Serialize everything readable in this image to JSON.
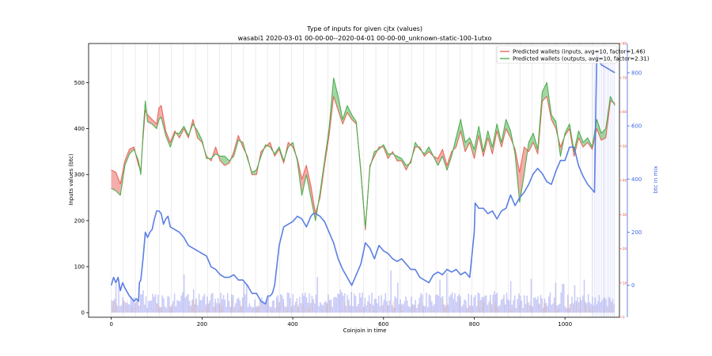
{
  "chart_data": {
    "type": "line",
    "title": "Type of inputs for given cjtx (values)",
    "subtitle": "wasabi1 2020-03-01 00-00-00--2020-04-01 00-00-00_unknown-static-100-1utxo",
    "xlabel": "Coinjoin in time",
    "ylabel_left": "Inputs values (btc)",
    "ylabel_right": "btc in mix",
    "xlim": [
      -50,
      1120
    ],
    "ylim_left": [
      -10,
      585
    ],
    "ylim_right1": [
      0,
      80
    ],
    "ylim_right2": [
      -120,
      910
    ],
    "x_ticks": [
      0,
      200,
      400,
      600,
      800,
      1000
    ],
    "y_ticks_left": [
      0,
      100,
      200,
      300,
      400,
      500
    ],
    "y_ticks_right1": [
      0,
      10,
      20,
      30,
      40,
      50,
      60,
      70,
      80
    ],
    "y_ticks_right2": [
      0,
      200,
      400,
      600,
      800
    ],
    "legend": {
      "placement": "top-right",
      "entries": [
        {
          "label": "Predicted wallets (inputs, avg=10, factor=1.46)",
          "color": "#e8685a"
        },
        {
          "label": "Predicted wallets (outputs, avg=10, factor=2.31)",
          "color": "#4caf50"
        }
      ]
    },
    "series": [
      {
        "name": "Predicted wallets (inputs, avg=10, factor=1.46)",
        "color": "#e8685a",
        "axis": "left",
        "x": [
          0,
          10,
          20,
          30,
          40,
          50,
          60,
          65,
          70,
          75,
          80,
          90,
          100,
          105,
          110,
          120,
          130,
          140,
          150,
          160,
          170,
          180,
          190,
          200,
          210,
          220,
          230,
          240,
          250,
          260,
          270,
          280,
          290,
          300,
          310,
          320,
          330,
          340,
          350,
          360,
          370,
          380,
          390,
          400,
          410,
          420,
          430,
          440,
          450,
          460,
          470,
          480,
          490,
          500,
          510,
          520,
          530,
          540,
          550,
          560,
          570,
          580,
          590,
          600,
          610,
          620,
          630,
          640,
          650,
          660,
          670,
          680,
          690,
          700,
          710,
          720,
          730,
          740,
          750,
          760,
          770,
          780,
          790,
          800,
          810,
          820,
          830,
          840,
          850,
          860,
          870,
          880,
          890,
          900,
          910,
          920,
          930,
          940,
          950,
          960,
          970,
          980,
          990,
          1000,
          1010,
          1020,
          1030,
          1040,
          1050,
          1060,
          1070,
          1080,
          1090,
          1100,
          1110
        ],
        "values": [
          310,
          305,
          280,
          330,
          355,
          360,
          320,
          310,
          380,
          440,
          430,
          420,
          410,
          445,
          450,
          395,
          370,
          395,
          380,
          400,
          380,
          420,
          380,
          370,
          340,
          330,
          360,
          330,
          320,
          325,
          350,
          385,
          360,
          340,
          300,
          300,
          350,
          360,
          370,
          340,
          355,
          325,
          370,
          360,
          335,
          290,
          320,
          275,
          215,
          250,
          320,
          385,
          470,
          440,
          410,
          435,
          420,
          410,
          310,
          180,
          320,
          340,
          360,
          360,
          335,
          350,
          330,
          330,
          310,
          330,
          360,
          360,
          340,
          350,
          340,
          335,
          355,
          320,
          350,
          360,
          395,
          350,
          370,
          335,
          385,
          340,
          380,
          345,
          395,
          360,
          400,
          380,
          355,
          305,
          360,
          350,
          370,
          345,
          460,
          470,
          420,
          400,
          360,
          385,
          400,
          340,
          380,
          360,
          370,
          355,
          400,
          375,
          380,
          460,
          455
        ]
      },
      {
        "name": "Predicted wallets (outputs, avg=10, factor=2.31)",
        "color": "#4caf50",
        "axis": "left",
        "x": [
          0,
          10,
          20,
          30,
          40,
          50,
          60,
          65,
          70,
          75,
          80,
          90,
          100,
          105,
          110,
          120,
          130,
          140,
          150,
          160,
          170,
          180,
          190,
          200,
          210,
          220,
          230,
          240,
          250,
          260,
          270,
          280,
          290,
          300,
          310,
          320,
          330,
          340,
          350,
          360,
          370,
          380,
          390,
          400,
          410,
          420,
          430,
          440,
          450,
          460,
          470,
          480,
          490,
          500,
          510,
          520,
          530,
          540,
          550,
          560,
          570,
          580,
          590,
          600,
          610,
          620,
          630,
          640,
          650,
          660,
          670,
          680,
          690,
          700,
          710,
          720,
          730,
          740,
          750,
          760,
          770,
          780,
          790,
          800,
          810,
          820,
          830,
          840,
          850,
          860,
          870,
          880,
          890,
          900,
          910,
          920,
          930,
          940,
          950,
          960,
          970,
          980,
          990,
          1000,
          1010,
          1020,
          1030,
          1040,
          1050,
          1060,
          1070,
          1080,
          1090,
          1100,
          1110
        ],
        "values": [
          270,
          265,
          255,
          320,
          345,
          355,
          330,
          300,
          390,
          460,
          415,
          410,
          400,
          420,
          425,
          385,
          360,
          390,
          390,
          405,
          385,
          410,
          395,
          375,
          335,
          335,
          345,
          340,
          340,
          330,
          340,
          375,
          370,
          335,
          305,
          310,
          340,
          365,
          360,
          345,
          360,
          330,
          360,
          370,
          330,
          255,
          300,
          250,
          200,
          260,
          330,
          400,
          510,
          470,
          420,
          450,
          430,
          415,
          305,
          185,
          315,
          350,
          355,
          365,
          345,
          345,
          340,
          335,
          320,
          325,
          370,
          355,
          345,
          360,
          340,
          320,
          340,
          310,
          340,
          380,
          420,
          370,
          380,
          355,
          405,
          350,
          395,
          360,
          410,
          370,
          420,
          395,
          345,
          240,
          300,
          370,
          390,
          355,
          480,
          500,
          430,
          415,
          340,
          390,
          410,
          350,
          395,
          370,
          380,
          360,
          420,
          390,
          400,
          470,
          450
        ]
      },
      {
        "name": "btc in mix",
        "color": "#5b7fe3",
        "axis": "right2",
        "x": [
          0,
          5,
          10,
          15,
          20,
          25,
          30,
          40,
          50,
          55,
          60,
          62,
          65,
          70,
          75,
          80,
          85,
          90,
          95,
          100,
          105,
          110,
          115,
          120,
          125,
          130,
          140,
          150,
          160,
          170,
          180,
          190,
          200,
          210,
          220,
          230,
          240,
          250,
          260,
          270,
          280,
          290,
          300,
          310,
          320,
          330,
          340,
          345,
          350,
          355,
          360,
          370,
          380,
          390,
          400,
          410,
          420,
          430,
          440,
          445,
          450,
          460,
          470,
          480,
          490,
          500,
          510,
          520,
          530,
          540,
          550,
          560,
          570,
          580,
          590,
          600,
          610,
          620,
          630,
          640,
          650,
          660,
          670,
          680,
          690,
          700,
          710,
          720,
          730,
          740,
          750,
          760,
          770,
          780,
          790,
          800,
          802,
          810,
          820,
          830,
          840,
          850,
          860,
          870,
          880,
          890,
          900,
          910,
          920,
          930,
          940,
          950,
          960,
          970,
          980,
          990,
          1000,
          1010,
          1020,
          1030,
          1040,
          1050,
          1060,
          1065,
          1070,
          1075,
          1080,
          1090,
          1100,
          1110
        ],
        "values": [
          0,
          30,
          10,
          30,
          -20,
          10,
          -10,
          -40,
          -60,
          -50,
          -60,
          10,
          20,
          100,
          200,
          180,
          200,
          210,
          250,
          280,
          280,
          270,
          230,
          250,
          260,
          220,
          210,
          200,
          180,
          150,
          140,
          130,
          120,
          110,
          70,
          60,
          40,
          30,
          30,
          40,
          20,
          20,
          0,
          -30,
          -30,
          -60,
          -70,
          -40,
          -40,
          -30,
          0,
          150,
          220,
          230,
          240,
          260,
          250,
          220,
          260,
          270,
          270,
          260,
          240,
          200,
          160,
          100,
          60,
          30,
          0,
          40,
          80,
          160,
          140,
          100,
          150,
          130,
          120,
          100,
          90,
          100,
          80,
          60,
          60,
          30,
          20,
          10,
          40,
          50,
          40,
          60,
          50,
          60,
          40,
          50,
          30,
          200,
          310,
          290,
          290,
          270,
          280,
          250,
          280,
          290,
          340,
          300,
          330,
          350,
          380,
          420,
          440,
          420,
          390,
          380,
          430,
          470,
          470,
          520,
          520,
          450,
          410,
          380,
          360,
          350,
          880,
          850,
          830,
          820,
          810,
          800
        ]
      }
    ]
  }
}
